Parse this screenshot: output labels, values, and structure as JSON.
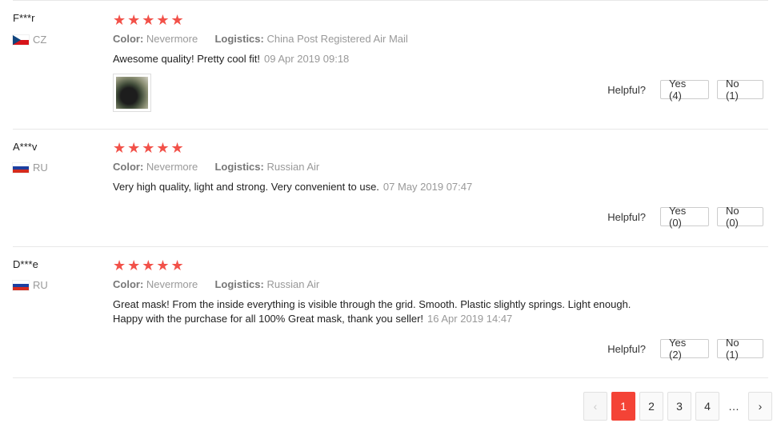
{
  "reviews": [
    {
      "user": "F***r",
      "country": "CZ",
      "flag": "flag-cz",
      "stars": "★★★★★",
      "color_label": "Color:",
      "color_value": "Nevermore",
      "logistics_label": "Logistics:",
      "logistics_value": "China Post Registered Air Mail",
      "text": "Awesome quality! Pretty cool fit!",
      "date": "09 Apr 2019 09:18",
      "has_photo": true,
      "helpful_label": "Helpful?",
      "yes_label": "Yes (4)",
      "no_label": "No (1)"
    },
    {
      "user": "A***v",
      "country": "RU",
      "flag": "flag-ru",
      "stars": "★★★★★",
      "color_label": "Color:",
      "color_value": "Nevermore",
      "logistics_label": "Logistics:",
      "logistics_value": "Russian Air",
      "text": "Very high quality, light and strong. Very convenient to use.",
      "date": "07 May 2019 07:47",
      "has_photo": false,
      "helpful_label": "Helpful?",
      "yes_label": "Yes (0)",
      "no_label": "No (0)"
    },
    {
      "user": "D***e",
      "country": "RU",
      "flag": "flag-ru",
      "stars": "★★★★★",
      "color_label": "Color:",
      "color_value": "Nevermore",
      "logistics_label": "Logistics:",
      "logistics_value": "Russian Air",
      "text_line1": "Great mask! From the inside everything is visible through the grid. Smooth. Plastic slightly springs. Light enough.",
      "text_line2": "Happy with the purchase for all 100% Great mask, thank you seller!",
      "date": "16 Apr 2019 14:47",
      "has_photo": false,
      "helpful_label": "Helpful?",
      "yes_label": "Yes (2)",
      "no_label": "No (1)"
    }
  ],
  "pagination": {
    "prev_icon": "‹",
    "pages": [
      "1",
      "2",
      "3",
      "4"
    ],
    "current": "1",
    "ellipsis": "…",
    "next_icon": "›"
  },
  "colors": {
    "star": "#f25149",
    "active_page": "#f44336"
  }
}
